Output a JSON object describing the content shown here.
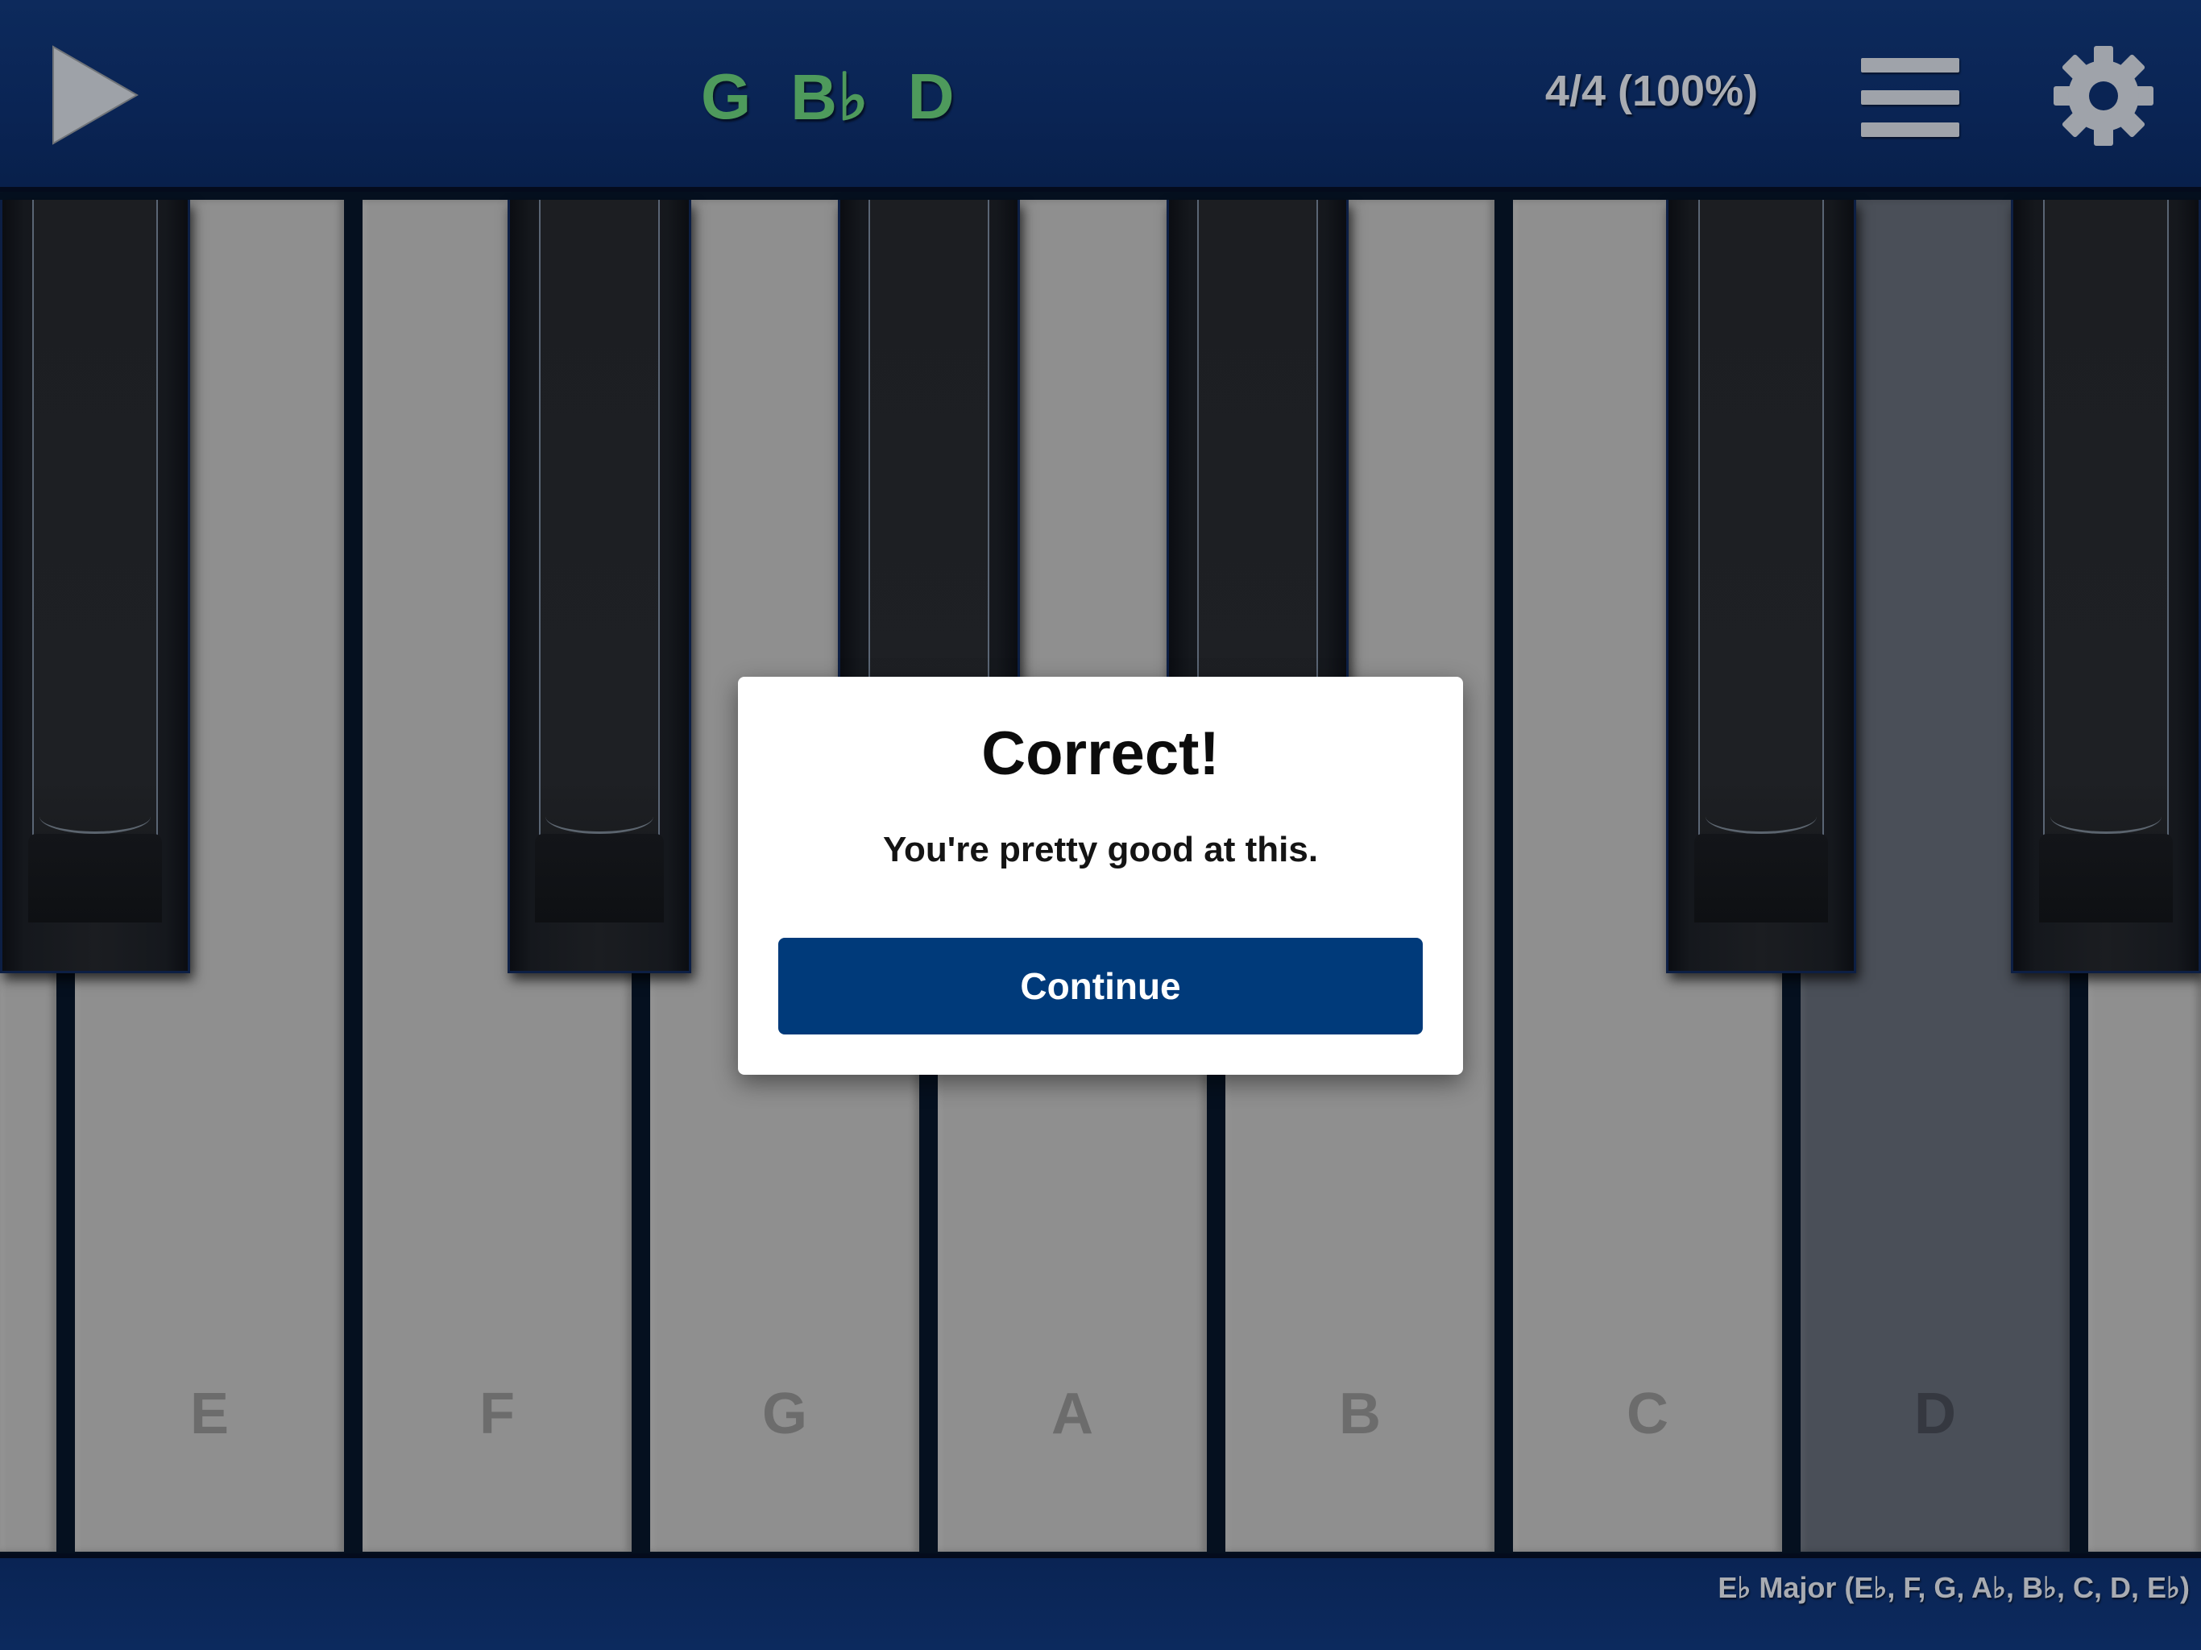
{
  "toolbar": {
    "play_icon": "play-icon",
    "chord_notes": [
      "G",
      "B♭",
      "D"
    ],
    "score": "4/4 (100%)",
    "menu_icon": "hamburger-menu-icon",
    "settings_icon": "gear-icon"
  },
  "keyboard": {
    "white_keys": [
      {
        "label": "E",
        "active": false
      },
      {
        "label": "F",
        "active": false
      },
      {
        "label": "G",
        "active": false
      },
      {
        "label": "A",
        "active": false
      },
      {
        "label": "B",
        "active": false
      },
      {
        "label": "C",
        "active": false
      },
      {
        "label": "D",
        "active": true
      }
    ],
    "active_key_color": "#4a4f58",
    "white_key_color": "#8f8f8f"
  },
  "footer": {
    "scale": "E♭ Major (E♭, F, G, A♭, B♭, C, D, E♭)"
  },
  "dialog": {
    "title": "Correct!",
    "message": "You're pretty good at this.",
    "button_label": "Continue",
    "button_color": "#003a7a"
  },
  "colors": {
    "chord_note": "#4e9a5c",
    "bar_background": "#0a2454"
  }
}
